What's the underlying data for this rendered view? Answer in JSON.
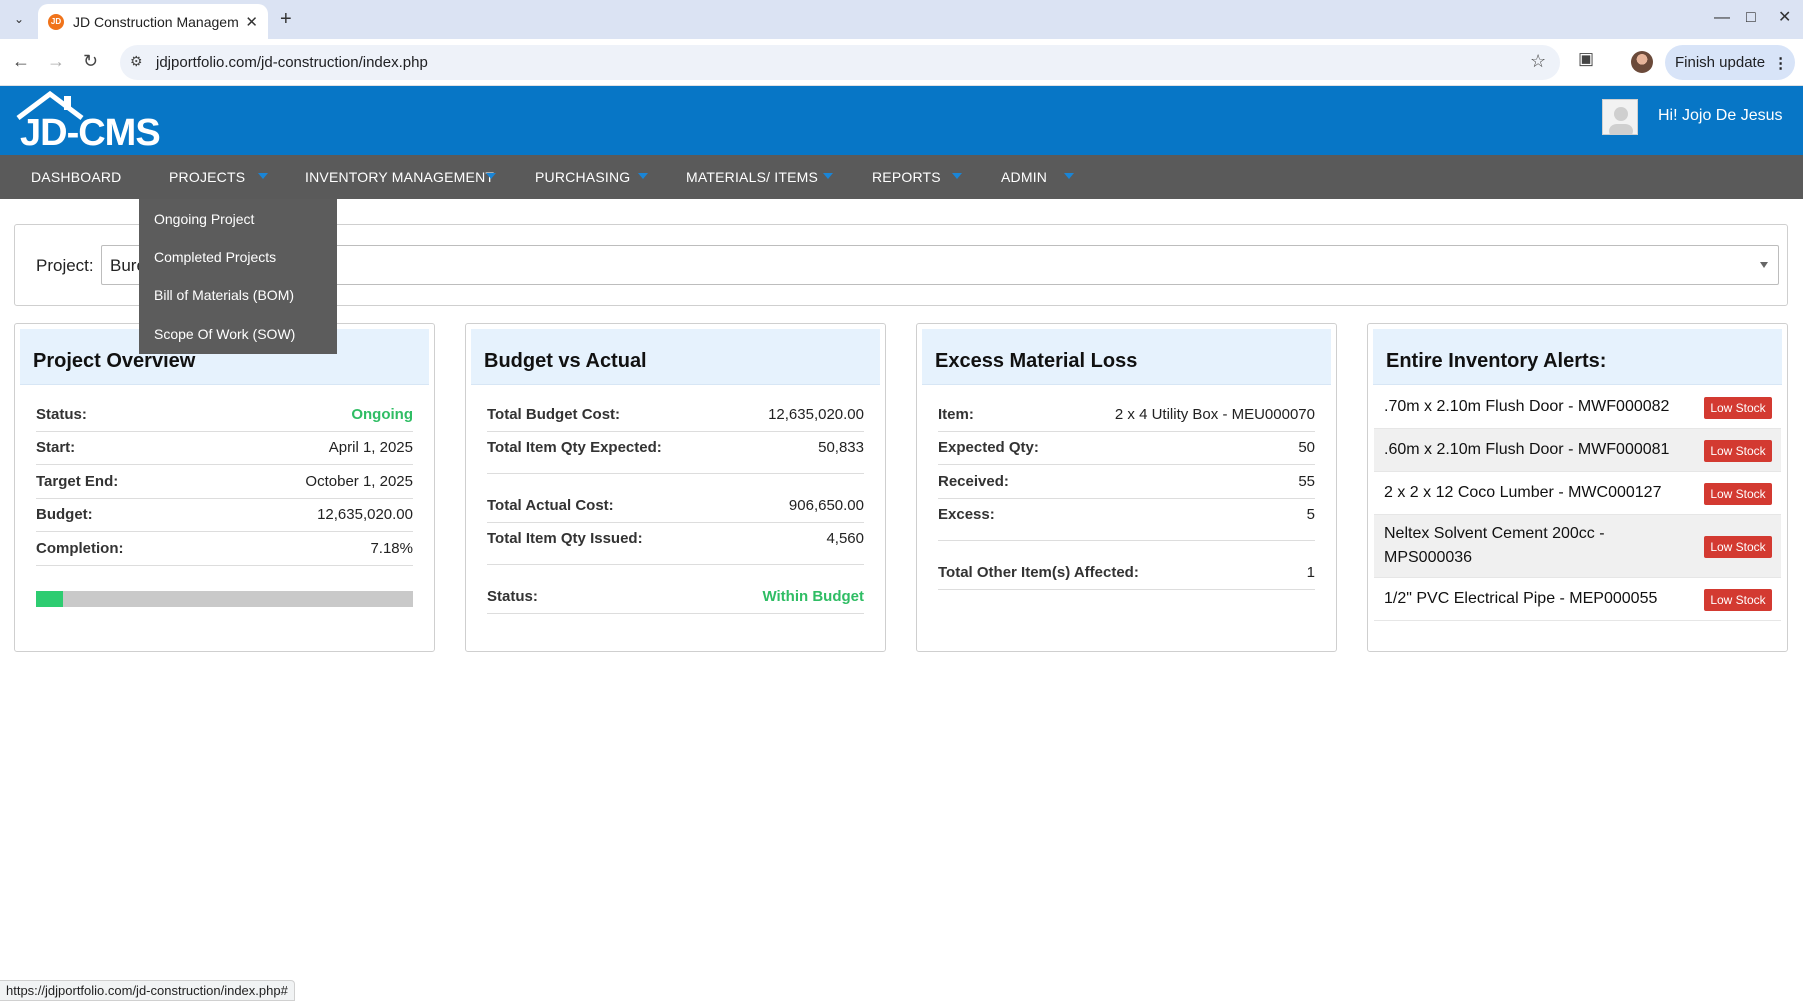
{
  "browser": {
    "tab_title": "JD Construction Managem",
    "url": "jdjportfolio.com/jd-construction/index.php",
    "finish_update_label": "Finish update",
    "status_url": "https://jdjportfolio.com/jd-construction/index.php#"
  },
  "app": {
    "logo_text": "JD-CMS",
    "greeting": "Hi! Jojo De Jesus",
    "brand_color": "#0776c6",
    "nav_color": "#5a5a5a"
  },
  "nav": {
    "dashboard": "DASHBOARD",
    "projects": "PROJECTS",
    "inventory": "INVENTORY MANAGEMENT",
    "purchasing": "PURCHASING",
    "materials": "MATERIALS/ ITEMS",
    "reports": "REPORTS",
    "admin": "ADMIN"
  },
  "projects_menu": {
    "items": [
      "Ongoing Project",
      "Completed Projects",
      "Bill of Materials (BOM)",
      "Scope Of Work (SOW)"
    ]
  },
  "project_selector": {
    "label": "Project:",
    "value": "Bureau of Fire"
  },
  "overview": {
    "title": "Project Overview",
    "rows": [
      {
        "label": "Status:",
        "value": "Ongoing"
      },
      {
        "label": "Start:",
        "value": "April 1, 2025"
      },
      {
        "label": "Target End:",
        "value": "October 1, 2025"
      },
      {
        "label": "Budget:",
        "value": "12,635,020.00"
      },
      {
        "label": "Completion:",
        "value": "7.18%"
      }
    ],
    "completion_fraction": 0.0718
  },
  "budget": {
    "title": "Budget vs Actual",
    "rows": [
      {
        "label": "Total Budget Cost:",
        "value": "12,635,020.00"
      },
      {
        "label": "Total Item Qty Expected:",
        "value": "50,833"
      },
      {
        "label": "Total Actual Cost:",
        "value": "906,650.00"
      },
      {
        "label": "Total Item Qty Issued:",
        "value": "4,560"
      },
      {
        "label": "Status:",
        "value": "Within Budget"
      }
    ]
  },
  "excess": {
    "title": "Excess Material Loss",
    "rows": [
      {
        "label": "Item:",
        "value": "2 x 4 Utility Box - MEU000070"
      },
      {
        "label": "Expected Qty:",
        "value": "50"
      },
      {
        "label": "Received:",
        "value": "55"
      },
      {
        "label": "Excess:",
        "value": "5"
      },
      {
        "label": "Total Other Item(s) Affected:",
        "value": "1"
      }
    ]
  },
  "alerts": {
    "title": "Entire Inventory Alerts:",
    "badge": "Low Stock",
    "items": [
      {
        "name": ".70m x 2.10m Flush Door - MWF000082"
      },
      {
        "name": ".60m x 2.10m Flush Door - MWF000081"
      },
      {
        "name": "2 x 2 x 12 Coco Lumber - MWC000127"
      },
      {
        "name_line1": "Neltex Solvent Cement 200cc -",
        "name_line2": "MPS000036"
      },
      {
        "name": "1/2\" PVC Electrical Pipe - MEP000055"
      }
    ]
  }
}
